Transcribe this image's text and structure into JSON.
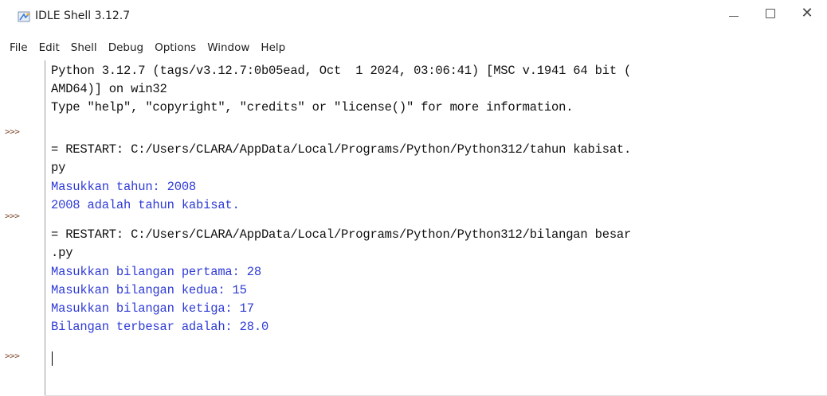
{
  "window": {
    "title": "IDLE Shell 3.12.7",
    "minimize_glyph": "—",
    "maximize_glyph": "☐",
    "close_glyph": "✕"
  },
  "menu": {
    "items": [
      "File",
      "Edit",
      "Shell",
      "Debug",
      "Options",
      "Window",
      "Help"
    ]
  },
  "shell": {
    "prompt": ">>>",
    "lines": [
      {
        "text": "Python 3.12.7 (tags/v3.12.7:0b05ead, Oct  1 2024, 03:06:41) [MSC v.1941 64 bit (",
        "kind": "stdout"
      },
      {
        "text": "AMD64)] on win32",
        "kind": "stdout"
      },
      {
        "text": "Type \"help\", \"copyright\", \"credits\" or \"license()\" for more information.",
        "kind": "stdout"
      },
      {
        "text": "= RESTART: C:/Users/CLARA/AppData/Local/Programs/Python/Python312/tahun kabisat.",
        "kind": "stdout"
      },
      {
        "text": "py",
        "kind": "stdout"
      },
      {
        "text": "Masukkan tahun: 2008",
        "kind": "output"
      },
      {
        "text": "2008 adalah tahun kabisat.",
        "kind": "output"
      },
      {
        "text": "= RESTART: C:/Users/CLARA/AppData/Local/Programs/Python/Python312/bilangan besar",
        "kind": "stdout"
      },
      {
        "text": ".py",
        "kind": "stdout"
      },
      {
        "text": "Masukkan bilangan pertama: 28",
        "kind": "output"
      },
      {
        "text": "Masukkan bilangan kedua: 15",
        "kind": "output"
      },
      {
        "text": "Masukkan bilangan ketiga: 17",
        "kind": "output"
      },
      {
        "text": "Bilangan terbesar adalah: 28.0",
        "kind": "output"
      }
    ]
  },
  "colors": {
    "output_text": "#2f3bd6",
    "prompt": "#7c4a2e",
    "stdout": "#111111"
  }
}
